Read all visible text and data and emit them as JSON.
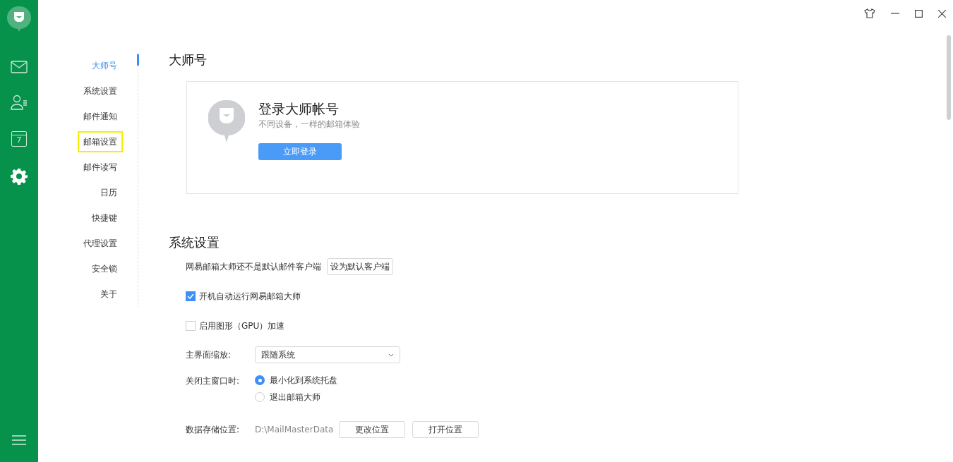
{
  "nav": [
    {
      "label": "大师号",
      "selected": true,
      "highlighted": false
    },
    {
      "label": "系统设置",
      "selected": false,
      "highlighted": false
    },
    {
      "label": "邮件通知",
      "selected": false,
      "highlighted": false
    },
    {
      "label": "邮箱设置",
      "selected": false,
      "highlighted": true
    },
    {
      "label": "邮件读写",
      "selected": false,
      "highlighted": false
    },
    {
      "label": "日历",
      "selected": false,
      "highlighted": false
    },
    {
      "label": "快捷键",
      "selected": false,
      "highlighted": false
    },
    {
      "label": "代理设置",
      "selected": false,
      "highlighted": false
    },
    {
      "label": "安全锁",
      "selected": false,
      "highlighted": false
    },
    {
      "label": "关于",
      "selected": false,
      "highlighted": false
    }
  ],
  "sidebar": {
    "items": [
      {
        "kind": "mail",
        "selected": false
      },
      {
        "kind": "contacts",
        "selected": false
      },
      {
        "kind": "calendar",
        "selected": false,
        "label": "7"
      },
      {
        "kind": "settings",
        "selected": true
      }
    ]
  },
  "account": {
    "heading": "大师号",
    "title": "登录大师帐号",
    "subtitle": "不同设备，一样的邮箱体验",
    "button": "立即登录"
  },
  "system": {
    "heading": "系统设置",
    "default_client": {
      "text": "网易邮箱大师还不是默认邮件客户端",
      "button": "设为默认客户端"
    },
    "checkboxes": [
      {
        "label": "开机自动运行网易邮箱大师",
        "checked": true
      },
      {
        "label": "启用图形（GPU）加速",
        "checked": false
      }
    ],
    "zoom": {
      "label": "主界面缩放:",
      "value": "跟随系统"
    },
    "close": {
      "label": "关闭主窗口时:",
      "options": [
        {
          "label": "最小化到系统托盘",
          "selected": true
        },
        {
          "label": "退出邮箱大师",
          "selected": false
        }
      ]
    },
    "storage": {
      "label": "数据存储位置:",
      "path": "D:\\MailMasterData",
      "buttons": [
        "更改位置",
        "打开位置"
      ]
    }
  }
}
